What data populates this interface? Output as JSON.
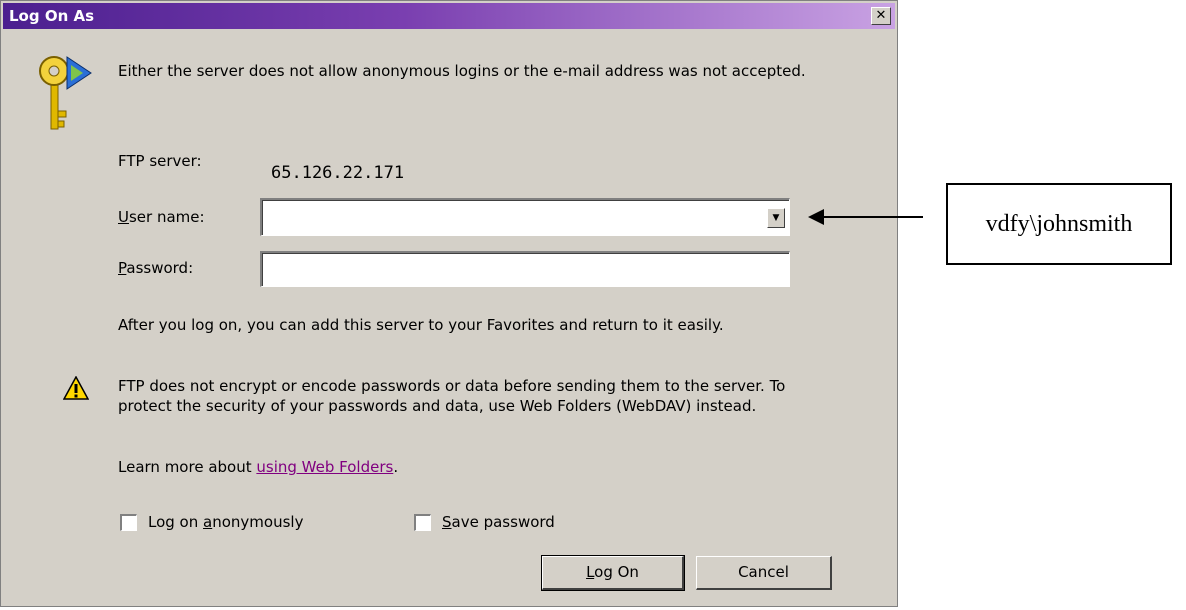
{
  "window": {
    "title": "Log On As",
    "close_glyph": "✕"
  },
  "message": "Either the server does not allow anonymous logins or the e-mail address was not accepted.",
  "ftp": {
    "label": "FTP server:",
    "value": "65.126.22.171"
  },
  "user": {
    "label_accel": "U",
    "label_rest": "ser name:",
    "value": ""
  },
  "password": {
    "label_accel": "P",
    "label_rest": "assword:",
    "value": ""
  },
  "after_logon": "After you log on, you can add this server to your Favorites and return to it easily.",
  "warning": "FTP does not encrypt or encode passwords or data before sending them to the server.  To protect the security of your passwords and data, use Web Folders (WebDAV) instead.",
  "learn": {
    "prefix": "Learn more about ",
    "link": "using Web Folders",
    "suffix": "."
  },
  "checkboxes": {
    "anonymous": {
      "pre": "Log on ",
      "accel": "a",
      "post": "nonymously",
      "checked": false
    },
    "save_password": {
      "pre": "",
      "accel": "S",
      "post": "ave password",
      "checked": false
    }
  },
  "buttons": {
    "logon": {
      "accel": "L",
      "rest": "og On"
    },
    "cancel": "Cancel"
  },
  "annotation": {
    "text": "vdfy\\johnsmith"
  },
  "icons": {
    "dialog": "keys-icon",
    "warning": "warning-icon",
    "dropdown": "chevron-down-icon",
    "close": "close-icon"
  }
}
